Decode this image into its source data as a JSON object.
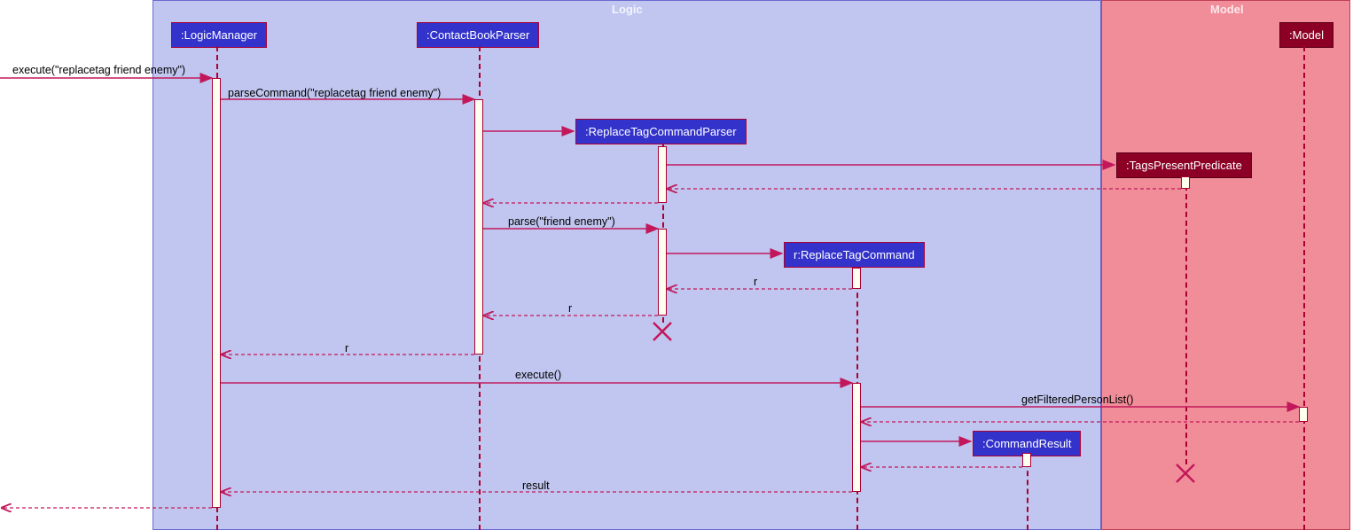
{
  "frames": {
    "logic": {
      "label": "Logic"
    },
    "model": {
      "label": "Model"
    }
  },
  "participants": {
    "logicManager": ":LogicManager",
    "contactBookParser": ":ContactBookParser",
    "replaceTagCommandParser": ":ReplaceTagCommandParser",
    "replaceTagCommand": "r:ReplaceTagCommand",
    "commandResult": ":CommandResult",
    "tagsPresentPredicate": ":TagsPresentPredicate",
    "model": ":Model"
  },
  "messages": {
    "m1": "execute(\"replacetag friend enemy\")",
    "m2": "parseCommand(\"replacetag friend enemy\")",
    "m3": "parse(\"friend enemy\")",
    "m4": "r",
    "m5": "r",
    "m6": "r",
    "m7": "execute()",
    "m8": "getFilteredPersonList()",
    "m9": "result"
  },
  "chart_data": {
    "type": "sequence-diagram",
    "frames": [
      {
        "name": "Logic",
        "participants": [
          "LogicManager",
          "ContactBookParser",
          "ReplaceTagCommandParser",
          "ReplaceTagCommand",
          "CommandResult"
        ]
      },
      {
        "name": "Model",
        "participants": [
          "TagsPresentPredicate",
          "Model"
        ]
      }
    ],
    "participants": [
      {
        "id": "ext",
        "name": "(external)"
      },
      {
        "id": "LogicManager",
        "name": ":LogicManager"
      },
      {
        "id": "ContactBookParser",
        "name": ":ContactBookParser"
      },
      {
        "id": "ReplaceTagCommandParser",
        "name": ":ReplaceTagCommandParser",
        "created": true,
        "destroyed": true
      },
      {
        "id": "ReplaceTagCommand",
        "name": "r:ReplaceTagCommand",
        "created": true
      },
      {
        "id": "CommandResult",
        "name": ":CommandResult",
        "created": true
      },
      {
        "id": "TagsPresentPredicate",
        "name": ":TagsPresentPredicate",
        "created": true,
        "destroyed": true
      },
      {
        "id": "Model",
        "name": ":Model"
      }
    ],
    "messages": [
      {
        "from": "ext",
        "to": "LogicManager",
        "label": "execute(\"replacetag friend enemy\")",
        "type": "call"
      },
      {
        "from": "LogicManager",
        "to": "ContactBookParser",
        "label": "parseCommand(\"replacetag friend enemy\")",
        "type": "call"
      },
      {
        "from": "ContactBookParser",
        "to": "ReplaceTagCommandParser",
        "label": "",
        "type": "create"
      },
      {
        "from": "ReplaceTagCommandParser",
        "to": "TagsPresentPredicate",
        "label": "",
        "type": "create"
      },
      {
        "from": "TagsPresentPredicate",
        "to": "ReplaceTagCommandParser",
        "label": "",
        "type": "return"
      },
      {
        "from": "ReplaceTagCommandParser",
        "to": "ContactBookParser",
        "label": "",
        "type": "return"
      },
      {
        "from": "ContactBookParser",
        "to": "ReplaceTagCommandParser",
        "label": "parse(\"friend enemy\")",
        "type": "call"
      },
      {
        "from": "ReplaceTagCommandParser",
        "to": "ReplaceTagCommand",
        "label": "",
        "type": "create"
      },
      {
        "from": "ReplaceTagCommand",
        "to": "ReplaceTagCommandParser",
        "label": "r",
        "type": "return"
      },
      {
        "from": "ReplaceTagCommandParser",
        "to": "ContactBookParser",
        "label": "r",
        "type": "return"
      },
      {
        "from": "ReplaceTagCommandParser",
        "to": null,
        "label": "",
        "type": "destroy"
      },
      {
        "from": "ContactBookParser",
        "to": "LogicManager",
        "label": "r",
        "type": "return"
      },
      {
        "from": "LogicManager",
        "to": "ReplaceTagCommand",
        "label": "execute()",
        "type": "call"
      },
      {
        "from": "ReplaceTagCommand",
        "to": "Model",
        "label": "getFilteredPersonList()",
        "type": "call"
      },
      {
        "from": "Model",
        "to": "ReplaceTagCommand",
        "label": "",
        "type": "return"
      },
      {
        "from": "ReplaceTagCommand",
        "to": "CommandResult",
        "label": "",
        "type": "create"
      },
      {
        "from": "CommandResult",
        "to": "ReplaceTagCommand",
        "label": "",
        "type": "return"
      },
      {
        "from": "TagsPresentPredicate",
        "to": null,
        "label": "",
        "type": "destroy"
      },
      {
        "from": "ReplaceTagCommand",
        "to": "LogicManager",
        "label": "result",
        "type": "return"
      },
      {
        "from": "LogicManager",
        "to": "ext",
        "label": "",
        "type": "return"
      }
    ]
  }
}
